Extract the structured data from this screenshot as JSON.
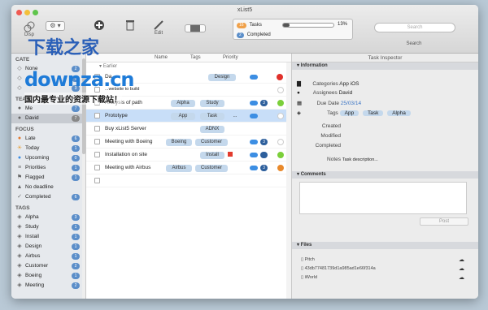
{
  "window": {
    "title": "xList5"
  },
  "toolbar": {
    "display_label": "Disp",
    "add_label": "",
    "edit_label": "Edit",
    "search_label": "Search",
    "search_placeholder": "Search"
  },
  "progress": {
    "tasks_label": "Tasks",
    "tasks_badge": "16",
    "tasks_percent": "13%",
    "tasks_fraction": 0.13,
    "completed_label": "Completed",
    "completed_badge": "2"
  },
  "sidebar": {
    "categories_title": "CATE",
    "categories": [
      {
        "label": "None",
        "badge": "2"
      },
      {
        "label": "",
        "badge": "1"
      },
      {
        "label": "",
        "badge": "3"
      }
    ],
    "team_title": "TEAM",
    "team": [
      {
        "label": "Me",
        "badge": "7"
      },
      {
        "label": "David",
        "badge": "7"
      }
    ],
    "focus_title": "FOCUS",
    "focus": [
      {
        "label": "Late",
        "badge": "6",
        "icon": "late-icon"
      },
      {
        "label": "Today",
        "badge": "1",
        "icon": "today-icon"
      },
      {
        "label": "Upcoming",
        "badge": "0",
        "icon": "upcoming-icon"
      },
      {
        "label": "Priorities",
        "badge": "1",
        "icon": "priority-icon"
      },
      {
        "label": "Flagged",
        "badge": "1",
        "icon": "flag-icon"
      },
      {
        "label": "No deadline",
        "badge": "",
        "icon": "no-deadline-icon"
      },
      {
        "label": "Completed",
        "badge": "6",
        "icon": "check-icon"
      }
    ],
    "tags_title": "TAGS",
    "tags": [
      {
        "label": "Alpha",
        "badge": "3"
      },
      {
        "label": "Study",
        "badge": "1"
      },
      {
        "label": "Install",
        "badge": "1"
      },
      {
        "label": "Design",
        "badge": "1"
      },
      {
        "label": "Airbus",
        "badge": "1"
      },
      {
        "label": "Customer",
        "badge": "2"
      },
      {
        "label": "Boeing",
        "badge": "1"
      },
      {
        "label": "Meeting",
        "badge": "2"
      }
    ]
  },
  "columns": {
    "name": "Name",
    "tags": "Tags",
    "priority": "Priority"
  },
  "list": {
    "group_label": "Earlier",
    "rows": [
      {
        "title": "Da",
        "tags": [
          "Design"
        ]
      },
      {
        "title": "...website to build",
        "tags": []
      },
      {
        "title": "Analysis of path",
        "tags": [
          "Alpha",
          "Study"
        ]
      },
      {
        "title": "Prototype",
        "tags": [
          "App",
          "Task",
          "..."
        ]
      },
      {
        "title": "Buy xList5 Server",
        "tags": [
          "ADNX"
        ]
      },
      {
        "title": "Meeting with Boeing",
        "tags": [
          "Boeing",
          "Customer"
        ]
      },
      {
        "title": "Installation on site",
        "tags": [
          "Install"
        ]
      },
      {
        "title": "Meeting with Airbus",
        "tags": [
          "Airbus",
          "Customer"
        ]
      },
      {
        "title": "",
        "tags": []
      }
    ],
    "badges": {
      "analysis": "3",
      "boeing": "3",
      "airbus": "3"
    }
  },
  "inspector": {
    "title": "Task Inspector",
    "info_section": "Information",
    "categories_label": "Categories",
    "categories_value": "App iOS",
    "assignees_label": "Assignees",
    "assignees_value": "David",
    "due_label": "Due Date",
    "due_value": "25/03/14",
    "tags_label": "Tags",
    "tags": [
      "App",
      "Task",
      "Alpha"
    ],
    "created_label": "Created",
    "modified_label": "Modified",
    "completed_label": "Completed",
    "notes_label": "Notes",
    "notes_value": "Task description...",
    "comments_section": "Comments",
    "post_label": "Post",
    "files_section": "Files",
    "files": [
      "Pitch",
      "43db77481739d1a985ad1e66f314a",
      "iWorld"
    ]
  },
  "watermark": {
    "line1": "下载之家",
    "line2": "downza.cn",
    "line3": "国内最专业的资源下载站！"
  },
  "colors": {
    "accent": "#5b8ec9",
    "selection": "#c8def8",
    "tag": "#c4d8ec",
    "cloud": "#3c8ee3"
  }
}
